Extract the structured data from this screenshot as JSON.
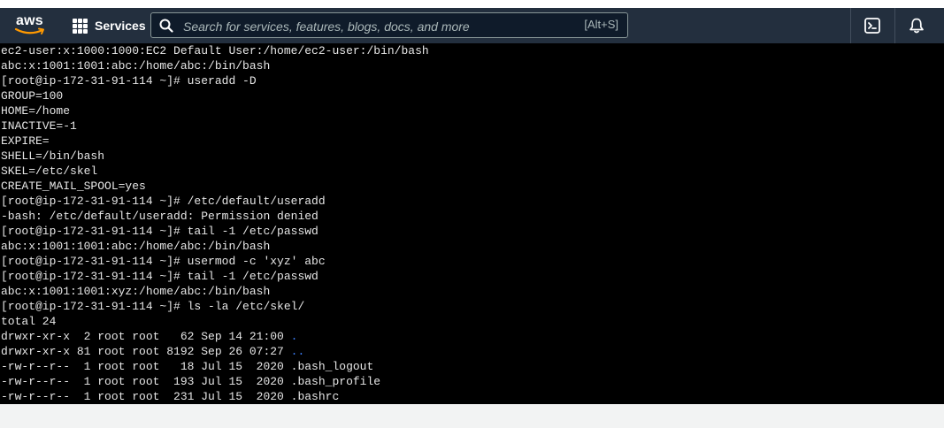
{
  "navbar": {
    "logo_text": "aws",
    "services_label": "Services",
    "search": {
      "placeholder": "Search for services, features, blogs, docs, and more",
      "value": "",
      "shortcut": "[Alt+S]"
    },
    "icons": {
      "cloudshell": "cloudshell-icon",
      "notifications": "bell-icon"
    }
  },
  "terminal": {
    "lines": [
      "ec2-user:x:1000:1000:EC2 Default User:/home/ec2-user:/bin/bash",
      "abc:x:1001:1001:abc:/home/abc:/bin/bash",
      "[root@ip-172-31-91-114 ~]# useradd -D",
      "GROUP=100",
      "HOME=/home",
      "INACTIVE=-1",
      "EXPIRE=",
      "SHELL=/bin/bash",
      "SKEL=/etc/skel",
      "CREATE_MAIL_SPOOL=yes",
      "[root@ip-172-31-91-114 ~]# /etc/default/useradd",
      "-bash: /etc/default/useradd: Permission denied",
      "[root@ip-172-31-91-114 ~]# tail -1 /etc/passwd",
      "abc:x:1001:1001:abc:/home/abc:/bin/bash",
      "[root@ip-172-31-91-114 ~]# usermod -c 'xyz' abc",
      "[root@ip-172-31-91-114 ~]# tail -1 /etc/passwd",
      "abc:x:1001:1001:xyz:/home/abc:/bin/bash",
      "[root@ip-172-31-91-114 ~]# ls -la /etc/skel/",
      "total 24"
    ],
    "listing": [
      {
        "prefix": "drwxr-xr-x  2 root root   62 Sep 14 21:00 ",
        "name": ".",
        "is_dir": true
      },
      {
        "prefix": "drwxr-xr-x 81 root root 8192 Sep 26 07:27 ",
        "name": "..",
        "is_dir": true
      },
      {
        "prefix": "-rw-r--r--  1 root root   18 Jul 15  2020 ",
        "name": ".bash_logout",
        "is_dir": false
      },
      {
        "prefix": "-rw-r--r--  1 root root  193 Jul 15  2020 ",
        "name": ".bash_profile",
        "is_dir": false
      },
      {
        "prefix": "-rw-r--r--  1 root root  231 Jul 15  2020 ",
        "name": ".bashrc",
        "is_dir": false
      }
    ],
    "colors": {
      "background": "#000000",
      "text": "#e6e6e6",
      "directory": "#3b7df7"
    }
  },
  "colors": {
    "navbar_bg": "#232f3e",
    "aws_smile": "#ff9900"
  }
}
